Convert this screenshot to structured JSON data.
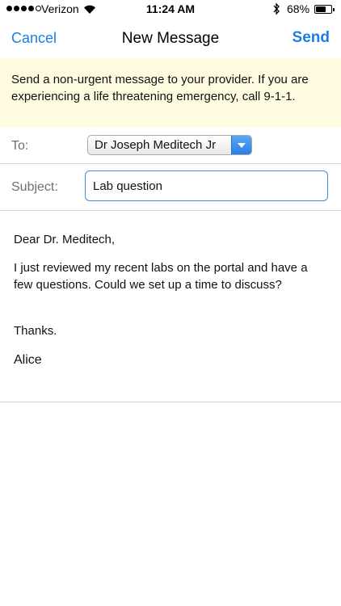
{
  "status_bar": {
    "carrier": "Verizon",
    "time": "11:24 AM",
    "battery_percent": "68%",
    "battery_level": 0.68,
    "signal_bars_filled": 4,
    "signal_bars_total": 5
  },
  "nav": {
    "cancel_label": "Cancel",
    "title": "New Message",
    "send_label": "Send",
    "accent_color": "#1a7fe0"
  },
  "notice": {
    "text": "Send a non-urgent message to your provider. If you are experiencing a life threatening emergency, call 9-1-1.",
    "background_color": "#fffbe0"
  },
  "form": {
    "to_label": "To:",
    "to_value": "Dr Joseph Meditech Jr",
    "subject_label": "Subject:",
    "subject_value": "Lab question"
  },
  "message": {
    "greeting": "Dear Dr. Meditech,",
    "paragraph": "I just reviewed my recent labs on the portal and have a few questions. Could we set up a time to discuss?",
    "signoff": "Thanks.",
    "signature": "Alice"
  }
}
